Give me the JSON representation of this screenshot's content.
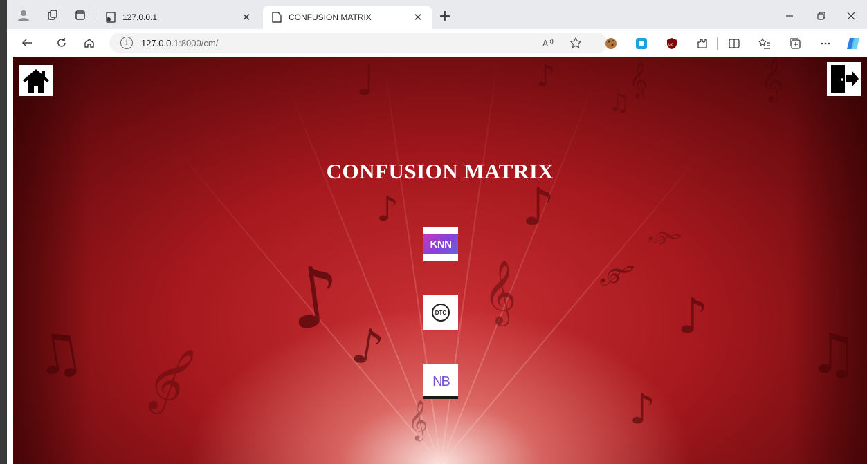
{
  "browser": {
    "tabs": [
      {
        "title": "127.0.0.1",
        "active": false
      },
      {
        "title": "CONFUSION MATRIX",
        "active": true
      }
    ],
    "new_tab_symbol": "+",
    "close_symbol": "✕",
    "address": {
      "host": "127.0.0.1",
      "path": ":8000/cm/"
    },
    "window_controls": [
      "minimize-icon",
      "restore-icon",
      "close-icon"
    ]
  },
  "page": {
    "title": "CONFUSION MATRIX",
    "nav": {
      "home_icon": "home-icon",
      "logout_icon": "logout-icon"
    },
    "models": [
      {
        "name": "knn-logo",
        "logo_text": "KNN"
      },
      {
        "name": "dtc-logo",
        "logo_text": "DTC"
      },
      {
        "name": "nb-logo",
        "logo_text": "NB"
      }
    ],
    "colors": {
      "background": "#a5181d",
      "title": "#ffffff"
    }
  }
}
